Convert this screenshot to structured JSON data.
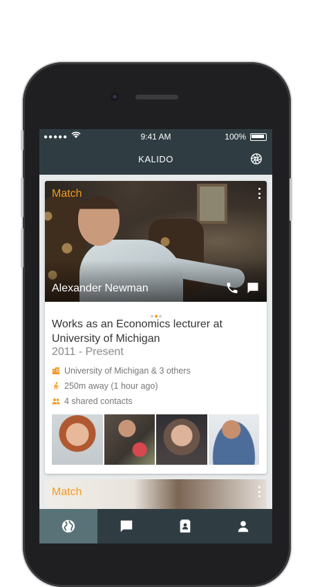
{
  "status_bar": {
    "signal": "●●●●●",
    "time": "9:41 AM",
    "battery": "100%"
  },
  "nav": {
    "title": "KALIDO"
  },
  "card": {
    "badge": "Match",
    "name": "Alexander Newman",
    "headline": "Works as an Economics lecturer at University of Michigan",
    "years": "2011 - Present",
    "info": [
      {
        "icon": "building-icon",
        "text": "University of Michigan & 3 others"
      },
      {
        "icon": "walking-icon",
        "text": "250m away (1 hour ago)"
      },
      {
        "icon": "people-icon",
        "text": "4 shared contacts"
      }
    ],
    "pager": {
      "count": 3,
      "active": 1
    }
  },
  "next_card": {
    "badge": "Match"
  },
  "tabs": [
    {
      "name": "discover",
      "active": true
    },
    {
      "name": "messages",
      "active": false
    },
    {
      "name": "contacts",
      "active": false
    },
    {
      "name": "profile",
      "active": false
    }
  ],
  "colors": {
    "accent": "#f29a22",
    "bar": "#2f3d43",
    "tab_active": "#597277"
  }
}
